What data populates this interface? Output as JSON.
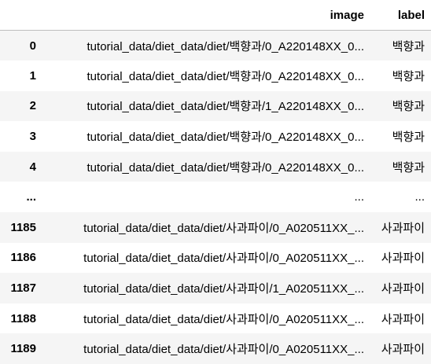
{
  "table": {
    "columns": [
      "",
      "image",
      "label"
    ],
    "rows": [
      {
        "index": "0",
        "image": "tutorial_data/diet_data/diet/백향과/0_A220148XX_0...",
        "label": "백향과"
      },
      {
        "index": "1",
        "image": "tutorial_data/diet_data/diet/백향과/0_A220148XX_0...",
        "label": "백향과"
      },
      {
        "index": "2",
        "image": "tutorial_data/diet_data/diet/백향과/1_A220148XX_0...",
        "label": "백향과"
      },
      {
        "index": "3",
        "image": "tutorial_data/diet_data/diet/백향과/0_A220148XX_0...",
        "label": "백향과"
      },
      {
        "index": "4",
        "image": "tutorial_data/diet_data/diet/백향과/0_A220148XX_0...",
        "label": "백향과"
      },
      {
        "index": "...",
        "image": "...",
        "label": "..."
      },
      {
        "index": "1185",
        "image": "tutorial_data/diet_data/diet/사과파이/0_A020511XX_...",
        "label": "사과파이"
      },
      {
        "index": "1186",
        "image": "tutorial_data/diet_data/diet/사과파이/0_A020511XX_...",
        "label": "사과파이"
      },
      {
        "index": "1187",
        "image": "tutorial_data/diet_data/diet/사과파이/1_A020511XX_...",
        "label": "사과파이"
      },
      {
        "index": "1188",
        "image": "tutorial_data/diet_data/diet/사과파이/0_A020511XX_...",
        "label": "사과파이"
      },
      {
        "index": "1189",
        "image": "tutorial_data/diet_data/diet/사과파이/0_A020511XX_...",
        "label": "사과파이"
      }
    ]
  }
}
